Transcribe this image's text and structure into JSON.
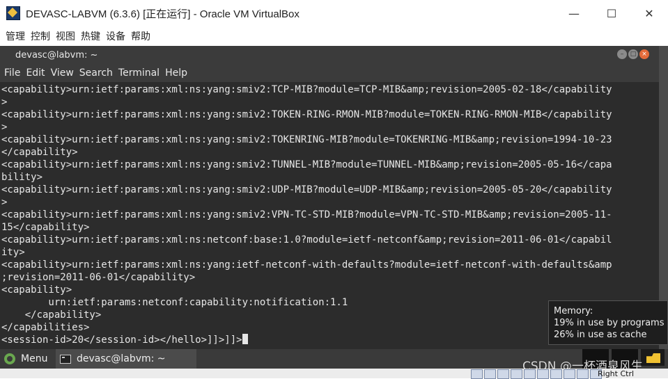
{
  "host_window": {
    "title": "DEVASC-LABVM (6.3.6) [正在运行] - Oracle VM VirtualBox",
    "minimize": "—",
    "maximize": "☐",
    "close": "✕",
    "menu": [
      "管理",
      "控制",
      "视图",
      "热键",
      "设备",
      "帮助"
    ]
  },
  "terminal": {
    "title": "devasc@labvm: ~",
    "menu": [
      "File",
      "Edit",
      "View",
      "Search",
      "Terminal",
      "Help"
    ],
    "lines": [
      "<capability>urn:ietf:params:xml:ns:yang:smiv2:TCP-MIB?module=TCP-MIB&amp;revision=2005-02-18</capability",
      ">",
      "<capability>urn:ietf:params:xml:ns:yang:smiv2:TOKEN-RING-RMON-MIB?module=TOKEN-RING-RMON-MIB</capability",
      ">",
      "<capability>urn:ietf:params:xml:ns:yang:smiv2:TOKENRING-MIB?module=TOKENRING-MIB&amp;revision=1994-10-23",
      "</capability>",
      "<capability>urn:ietf:params:xml:ns:yang:smiv2:TUNNEL-MIB?module=TUNNEL-MIB&amp;revision=2005-05-16</capa",
      "bility>",
      "<capability>urn:ietf:params:xml:ns:yang:smiv2:UDP-MIB?module=UDP-MIB&amp;revision=2005-05-20</capability",
      ">",
      "<capability>urn:ietf:params:xml:ns:yang:smiv2:VPN-TC-STD-MIB?module=VPN-TC-STD-MIB&amp;revision=2005-11-",
      "15</capability>",
      "<capability>urn:ietf:params:xml:ns:netconf:base:1.0?module=ietf-netconf&amp;revision=2011-06-01</capabil",
      "ity>",
      "<capability>urn:ietf:params:xml:ns:yang:ietf-netconf-with-defaults?module=ietf-netconf-with-defaults&amp",
      ";revision=2011-06-01</capability>",
      "<capability>",
      "        urn:ietf:params:netconf:capability:notification:1.1",
      "    </capability>",
      "</capabilities>"
    ],
    "prompt_line": "<session-id>20</session-id></hello>]]>]]>"
  },
  "memory_tooltip": {
    "title": "Memory:",
    "programs": "19% in use by programs",
    "cache": "26% in use as cache"
  },
  "taskbar": {
    "menu_label": "Menu",
    "task_label": "devasc@labvm: ~"
  },
  "statusbar": {
    "host_key": "Right Ctrl"
  },
  "watermark": "CSDN @一杯酒泉风生"
}
